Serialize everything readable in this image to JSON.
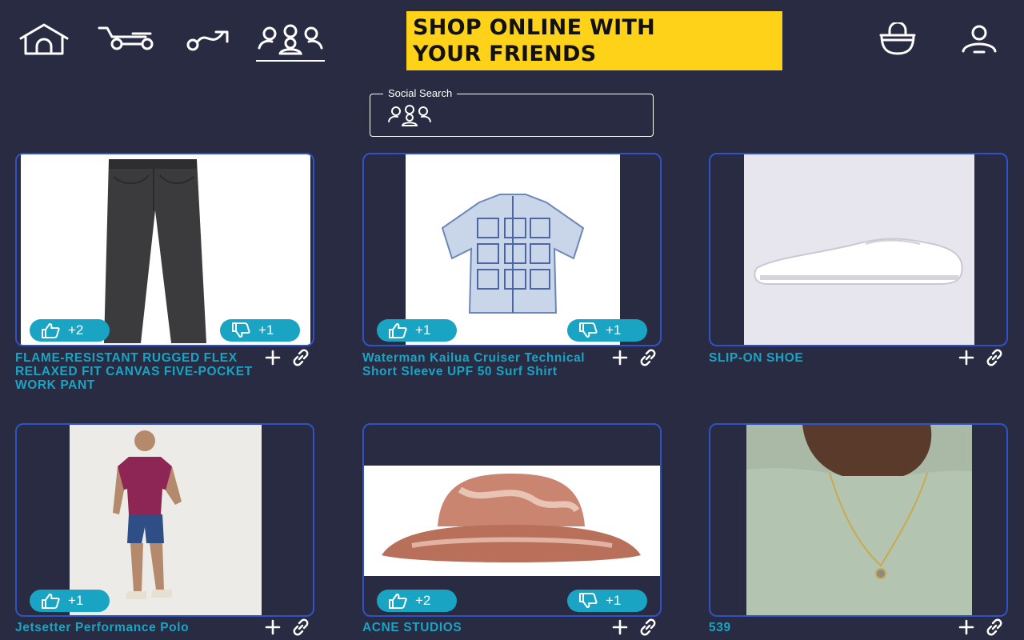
{
  "header": {
    "banner_line1": "SHOP ONLINE WITH",
    "banner_line2": "YOUR FRIENDS",
    "nav_icons": [
      "home-icon",
      "cart-icon",
      "route-icon",
      "friends-icon"
    ],
    "right_icons": [
      "bag-icon",
      "profile-icon"
    ]
  },
  "search": {
    "label": "Social Search",
    "value": ""
  },
  "colors": {
    "background": "#282b41",
    "accent": "#1aa4c4",
    "banner": "#ffd21a",
    "card_border": "#2f53c5"
  },
  "products": [
    {
      "title": "FLAME-RESISTANT RUGGED FLEX RELAXED FIT CANVAS FIVE-POCKET WORK PANT",
      "likes": "+2",
      "dislikes": "+1"
    },
    {
      "title": "Waterman Kailua Cruiser Technical Short Sleeve UPF 50 Surf Shirt",
      "likes": "+1",
      "dislikes": "+1"
    },
    {
      "title": "SLIP-ON SHOE"
    },
    {
      "title": "Jetsetter Performance Polo",
      "likes": "+1"
    },
    {
      "title": "ACNE STUDIOS",
      "likes": "+2",
      "dislikes": "+1"
    },
    {
      "title": "539"
    }
  ]
}
